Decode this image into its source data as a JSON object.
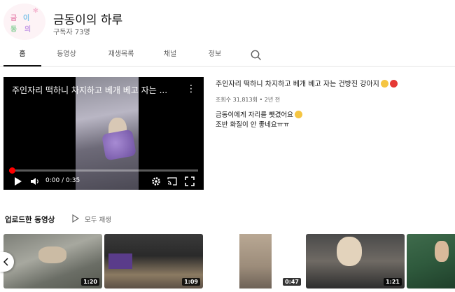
{
  "channel": {
    "name": "금동이의 하루",
    "subscribers": "구독자 73명",
    "avatar_text": [
      "금",
      "동",
      "이",
      "의"
    ]
  },
  "tabs": [
    {
      "label": "홈",
      "active": true
    },
    {
      "label": "동영상",
      "active": false
    },
    {
      "label": "재생목록",
      "active": false
    },
    {
      "label": "채널",
      "active": false
    },
    {
      "label": "정보",
      "active": false
    }
  ],
  "featured": {
    "player_title": "주인자리 떡하니 차지하고 베개 베고 자는 ...",
    "time": "0:00 / 0:35",
    "progress": 0.0,
    "title": "주인자리 떡하니 차지하고 베개 베고 자는 건방진 강아지",
    "meta": "조회수 31,813회 • 2년 전",
    "description_lines": [
      "금동이에게 자리를 뺏겼어요",
      "조반 화질이 안 좋네요ㅠㅠ"
    ]
  },
  "uploads": {
    "title": "업로드한 동영상",
    "play_all": "모두 재생",
    "videos": [
      {
        "duration": "1:20"
      },
      {
        "duration": "1:09"
      },
      {
        "duration": "0:47"
      },
      {
        "duration": "1:21"
      },
      {
        "duration": ""
      }
    ]
  },
  "colors": {
    "accent": "#ff0000",
    "text_primary": "#0f0f0f",
    "text_secondary": "#606060"
  },
  "icons": {
    "search": "magnifier",
    "play": "triangle",
    "volume": "speaker",
    "settings": "gear",
    "cast": "cast",
    "fullscreen": "fullscreen-corners",
    "more": "vertical-dots",
    "prev": "chevron-left"
  }
}
